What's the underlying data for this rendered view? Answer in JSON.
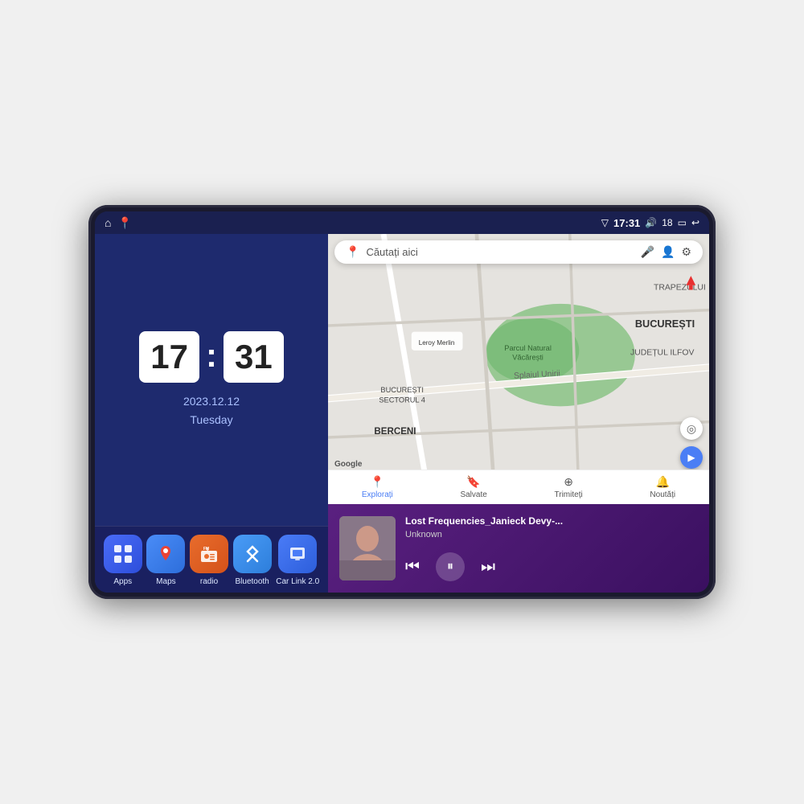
{
  "device": {
    "screen": {
      "status_bar": {
        "left_icons": [
          "⌂",
          "📍"
        ],
        "time": "17:31",
        "signal_icon": "▽",
        "volume_icon": "🔊",
        "battery": "18",
        "battery_icon": "▭",
        "back_icon": "↩"
      },
      "clock_widget": {
        "hour": "17",
        "minute": "31",
        "date": "2023.12.12",
        "day": "Tuesday"
      },
      "apps": [
        {
          "id": "apps",
          "label": "Apps",
          "icon": "⊞",
          "bg_class": "apps-bg"
        },
        {
          "id": "maps",
          "label": "Maps",
          "icon": "📍",
          "bg_class": "maps-bg"
        },
        {
          "id": "radio",
          "label": "radio",
          "icon": "📻",
          "bg_class": "radio-bg"
        },
        {
          "id": "bluetooth",
          "label": "Bluetooth",
          "icon": "⬡",
          "bg_class": "bluetooth-bg"
        },
        {
          "id": "carlink",
          "label": "Car Link 2.0",
          "icon": "📱",
          "bg_class": "carlink-bg"
        }
      ],
      "map_widget": {
        "search_placeholder": "Căutați aici",
        "nav_items": [
          {
            "id": "explore",
            "label": "Explorați",
            "icon": "📍",
            "active": true
          },
          {
            "id": "saved",
            "label": "Salvate",
            "icon": "🔖",
            "active": false
          },
          {
            "id": "share",
            "label": "Trimiteți",
            "icon": "⊕",
            "active": false
          },
          {
            "id": "news",
            "label": "Noutăți",
            "icon": "🔔",
            "active": false
          }
        ],
        "locations": [
          "TRAPEZULUI",
          "BUCUREȘTI",
          "JUDEȚUL ILFOV",
          "Parcul Natural Văcărești",
          "Leroy Merlin",
          "BERCENI",
          "BUCUREȘTI SECTORUL 4"
        ],
        "google_logo": "Google"
      },
      "music_widget": {
        "title": "Lost Frequencies_Janieck Devy-...",
        "artist": "Unknown",
        "controls": {
          "prev": "⏮",
          "play": "⏸",
          "next": "⏭"
        }
      }
    }
  }
}
